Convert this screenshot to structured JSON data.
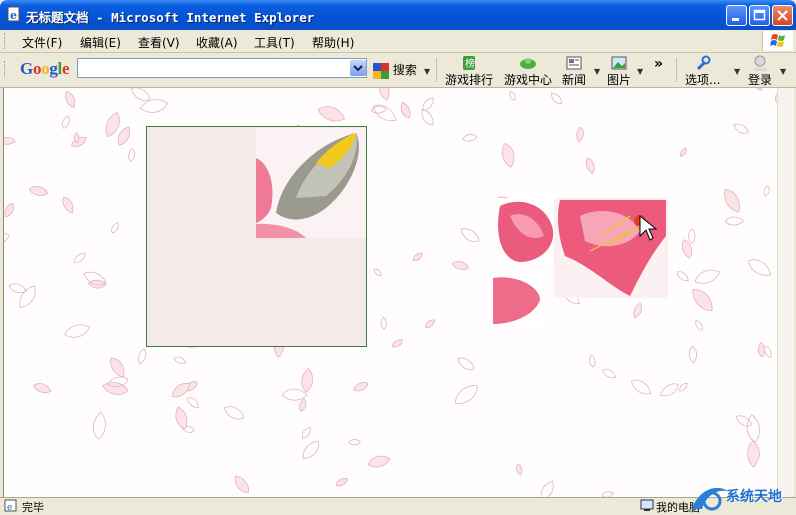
{
  "window": {
    "title": "无标题文档 - Microsoft Internet Explorer"
  },
  "menu": {
    "items": [
      "文件(F)",
      "编辑(E)",
      "查看(V)",
      "收藏(A)",
      "工具(T)",
      "帮助(H)"
    ]
  },
  "google_toolbar": {
    "logo": "Google",
    "search_value": "",
    "buttons": {
      "search": "搜索",
      "game_rank": "游戏排行",
      "game_center": "游戏中心",
      "news": "新闻",
      "images": "图片",
      "more": "»",
      "options": "选项...",
      "login": "登录"
    }
  },
  "status": {
    "text": "完毕",
    "zone": "我的电脑"
  },
  "watermark": {
    "text": "系统天地"
  },
  "colors": {
    "titlebar": "#0553d4",
    "drop_box_border": "#3f7a3f",
    "drop_box_fill": "#f5eaea",
    "petal_pink": "#ec5a7c"
  }
}
